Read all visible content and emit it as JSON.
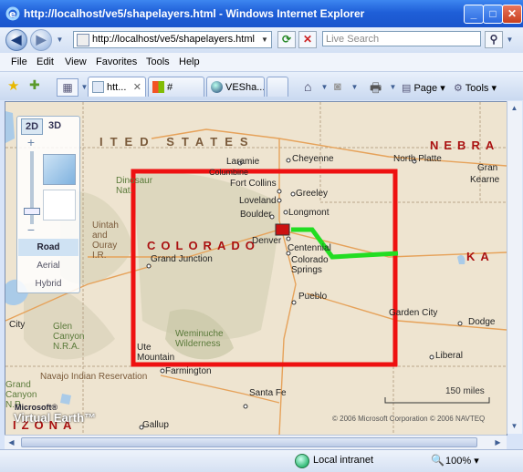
{
  "window": {
    "title": "http://localhost/ve5/shapelayers.html - Windows Internet Explorer",
    "minimize": "_",
    "maximize": "□",
    "close": "✕"
  },
  "address": {
    "url": "http://localhost/ve5/shapelayers.html",
    "search_placeholder": "Live Search"
  },
  "menu": [
    "File",
    "Edit",
    "View",
    "Favorites",
    "Tools",
    "Help"
  ],
  "tabs": [
    {
      "label": "htt...",
      "active": true
    },
    {
      "label": "#",
      "active": false
    },
    {
      "label": "VESha...",
      "active": false
    }
  ],
  "commands": {
    "page": "Page",
    "tools": "Tools"
  },
  "map": {
    "dim_2d": "2D",
    "dim_3d": "3D",
    "styles": [
      "Road",
      "Aerial",
      "Hybrid"
    ],
    "active_style": "Road",
    "title_us": "ITED STATES",
    "state_co": "COLORADO",
    "state_ne": "NEBRA",
    "state_ka": "KA",
    "state_az": "IZONA",
    "cities": {
      "laramie": "Laramie",
      "cheyenne": "Cheyenne",
      "north_platte": "North Platte",
      "columbine": "Columbine",
      "fort_collins": "Fort Collins",
      "greeley": "Greeley",
      "loveland": "Loveland",
      "boulder": "Boulder",
      "longmont": "Longmont",
      "denver": "Denver",
      "centennial": "Centennial",
      "colorado_springs": "Colorado\nSprings",
      "pueblo": "Pueblo",
      "grand_junction": "Grand Junction",
      "garden_city": "Garden City",
      "dodge": "Dodge",
      "liberal": "Liberal",
      "farmington": "Farmington",
      "santa_fe": "Santa Fe",
      "gallup": "Gallup",
      "city": "City",
      "gran": "Gran",
      "kearne": "Kearne",
      "ute_mountain": "Ute\nMountain"
    },
    "parks": {
      "dinosaur": "Dinosaur\nNat.",
      "uintah": "Uintah\nand\nOuray\nI.R.",
      "weminuche": "Weminuche\nWilderness",
      "glen_canyon": "Glen\nCanyon\nN.R.A.",
      "navajo": "Navajo Indian Reservation",
      "grand_canyon": "Grand\nCanyon\nN.P."
    },
    "scale": "150 miles",
    "copyright": "© 2006 Microsoft Corporation   © 2006 NAVTEQ",
    "brand_small": "Microsoft®",
    "brand": "Virtual Earth™"
  },
  "status": {
    "zone": "Local intranet",
    "zoom": "100%"
  }
}
